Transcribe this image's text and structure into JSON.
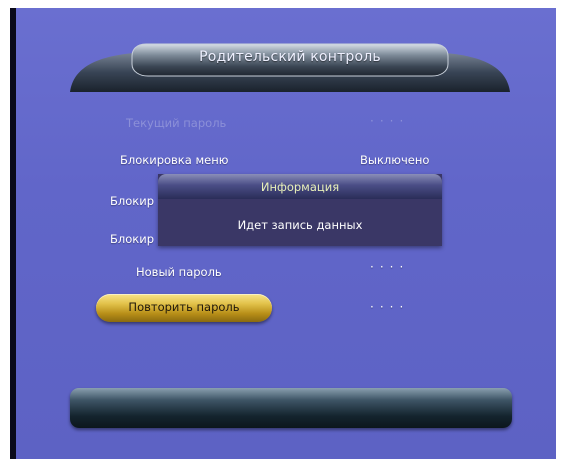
{
  "header": {
    "title": "Родительский контроль"
  },
  "rows": {
    "current_password": {
      "label": "Текущий пароль",
      "value": "····"
    },
    "menu_lock": {
      "label": "Блокировка меню",
      "value": "Выключено"
    },
    "lock_2": {
      "label": "Блокир"
    },
    "lock_3": {
      "label": "Блокир"
    },
    "new_password": {
      "label": "Новый пароль",
      "value": "····"
    },
    "confirm_password": {
      "label": "Повторить пароль",
      "value": "····"
    }
  },
  "dialog": {
    "title": "Информация",
    "message": "Идет запись данных"
  },
  "colors": {
    "background": "#6166c9",
    "highlight": "#e2c24a",
    "dialog": "#3a3766"
  }
}
